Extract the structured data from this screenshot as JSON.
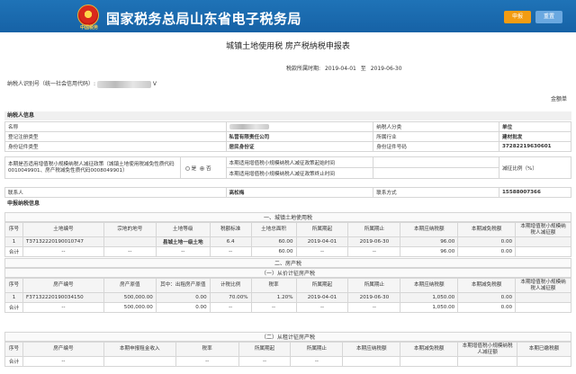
{
  "header": {
    "site_title": "国家税务总局山东省电子税务局",
    "emblem_caption": "中国税务",
    "declare_button": "申报",
    "reset_button": "重置",
    "accent": "#1f73b7"
  },
  "form": {
    "title": "城镇土地使用税 房产税纳税申报表",
    "period_label": "税款所属时期:",
    "period_start": "2019-04-01",
    "period_to": "至",
    "period_end": "2019-06-30",
    "taxpayer_id_label": "纳税人识别号（统一社会信用代码）:",
    "taxpayer_id_suffix": "V",
    "unit_label": "金额单"
  },
  "taxpayer_info": {
    "section_label": "纳税人信息",
    "name_label": "名称",
    "taxpayer_class_label": "纳税人分类",
    "taxpayer_class_value": "单位",
    "reg_type_label": "登记注册类型",
    "reg_type_value": "私营有限责任公司",
    "industry_label": "所属行业",
    "industry_value": "建材批发",
    "id_type_label": "身份证件类型",
    "id_type_value": "居民身份证",
    "id_no_label": "身份证件号码",
    "id_no_value": "37282219630601",
    "relief_q": "本期是否适用增值税小规模纳税人减征政策（城镇土地使用税减免性质代码0010049901、房产税减免性质代码0008049901）",
    "yes": "是",
    "no": "否",
    "relief_start": "本期适用增值税小规模纳税人减征政策起始时间",
    "relief_end": "本期适用增值税小规模纳税人减征政策终止时间",
    "relief_ratio": "减征比例（%）",
    "contact_label": "联系人",
    "contact_value": "高松梅",
    "phone_label": "联系方式",
    "phone_value": "15588007366"
  },
  "declare_info": {
    "section_label": "申报纳税信息",
    "land_section": "一、城镇土地使用税",
    "land_headers": [
      "序号",
      "土地编号",
      "宗地的地号",
      "土地等级",
      "税额标准",
      "土地总面积",
      "所属期起",
      "所属期止",
      "本期应纳税额",
      "本期减免税额",
      "本期增值税小规模纳税人减征额"
    ],
    "land_rows": [
      [
        "1",
        "T37132220190010747",
        "",
        "县城土地一级土地",
        "6.4",
        "60.00",
        "2019-04-01",
        "2019-06-30",
        "96.00",
        "0.00",
        ""
      ]
    ],
    "land_total": [
      "合计",
      "--",
      "--",
      "--",
      "--",
      "60.00",
      "--",
      "--",
      "96.00",
      "0.00",
      ""
    ],
    "house_section": "二、房产税",
    "house_sub1": "（一）从价计征房产税",
    "house_headers": [
      "序号",
      "房产编号",
      "房产原值",
      "其中：出租房产原值",
      "计税比例",
      "税率",
      "所属期起",
      "所属期止",
      "本期应纳税额",
      "本期减免税额",
      "本期增值税小规模纳税人减征额"
    ],
    "house_rows": [
      [
        "1",
        "F37132220190034150",
        "500,000.00",
        "0.00",
        "70.00%",
        "1.20%",
        "2019-04-01",
        "2019-06-30",
        "1,050.00",
        "0.00",
        ""
      ]
    ],
    "house_total": [
      "合计",
      "--",
      "500,000.00",
      "0.00",
      "--",
      "--",
      "--",
      "--",
      "1,050.00",
      "0.00",
      ""
    ],
    "rent_sub": "（二）从租计征房产税",
    "rent_headers": [
      "序号",
      "房产编号",
      "本期申报租金收入",
      "税率",
      "所属期起",
      "所属期止",
      "本期应纳税额",
      "本期减免税额",
      "本期增值税小规模纳税人减征额",
      "本期已缴税额"
    ],
    "rent_total": [
      "合计",
      "--",
      "",
      "--",
      "--",
      "--",
      "",
      "",
      "",
      ""
    ]
  }
}
